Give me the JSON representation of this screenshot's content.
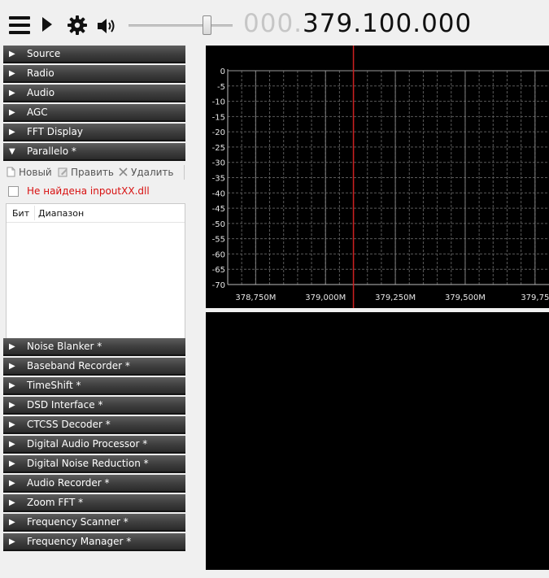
{
  "toolbar": {
    "icons": [
      "menu-icon",
      "play-icon",
      "gear-icon",
      "speaker-icon"
    ],
    "volume_level": 0.78,
    "frequency_dim": "000.",
    "frequency_main": "379.100.000"
  },
  "sections_top": [
    {
      "label": "Source",
      "arrow": "▶"
    },
    {
      "label": "Radio",
      "arrow": "▶"
    },
    {
      "label": "Audio",
      "arrow": "▶"
    },
    {
      "label": "AGC",
      "arrow": "▶"
    },
    {
      "label": "FFT Display",
      "arrow": "▶"
    },
    {
      "label": "Parallelo *",
      "arrow": "▼"
    }
  ],
  "parallelo": {
    "new_label": "Новый",
    "edit_label": "Править",
    "delete_label": "Удалить",
    "dll_warning": "Не найдена inpoutXX.dll",
    "table_headers": [
      "Бит",
      "Диапазон"
    ]
  },
  "sections_bottom": [
    {
      "label": "Noise Blanker *",
      "arrow": "▶"
    },
    {
      "label": "Baseband Recorder *",
      "arrow": "▶"
    },
    {
      "label": "TimeShift *",
      "arrow": "▶"
    },
    {
      "label": "DSD Interface *",
      "arrow": "▶"
    },
    {
      "label": "CTCSS Decoder *",
      "arrow": "▶"
    },
    {
      "label": "Digital Audio Processor *",
      "arrow": "▶"
    },
    {
      "label": "Digital Noise Reduction *",
      "arrow": "▶"
    },
    {
      "label": "Audio Recorder *",
      "arrow": "▶"
    },
    {
      "label": "Zoom FFT *",
      "arrow": "▶"
    },
    {
      "label": "Frequency Scanner *",
      "arrow": "▶"
    },
    {
      "label": "Frequency Manager *",
      "arrow": "▶"
    }
  ],
  "spectrum": {
    "y_ticks": [
      "0",
      "-5",
      "-10",
      "-15",
      "-20",
      "-25",
      "-30",
      "-35",
      "-40",
      "-45",
      "-50",
      "-55",
      "-60",
      "-65",
      "-70"
    ],
    "x_ticks": [
      "378,750M",
      "379,000M",
      "379,250M",
      "379,500M",
      "379,75"
    ],
    "y_range_db": [
      -70,
      0
    ],
    "x_tick_values_mhz": [
      378.75,
      379.0,
      379.25,
      379.5,
      379.75
    ],
    "tuned_frequency_mhz": 379.1,
    "colors": {
      "background": "#000000",
      "grid": "#5a5a5a",
      "axis_text": "#e6e6e6",
      "marker": "#cc2020"
    }
  }
}
